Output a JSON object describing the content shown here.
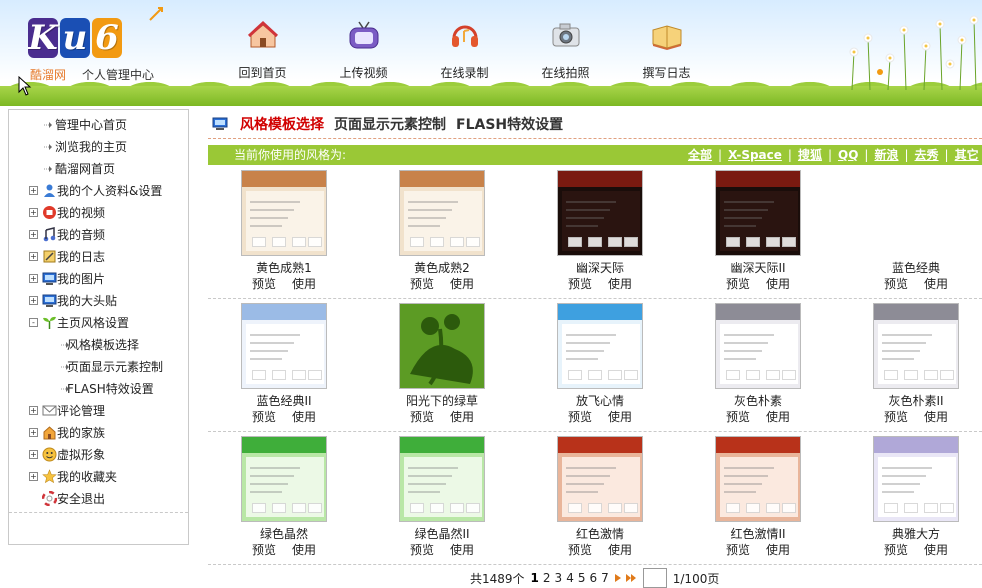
{
  "header": {
    "logo_letters": [
      "K",
      "u",
      "6"
    ],
    "site_name": "酷溜网",
    "site_sub": "个人管理中心",
    "nav": [
      {
        "label": "回到首页",
        "icon": "home-icon"
      },
      {
        "label": "上传视频",
        "icon": "tv-icon"
      },
      {
        "label": "在线录制",
        "icon": "headphones-icon"
      },
      {
        "label": "在线拍照",
        "icon": "camera-icon"
      },
      {
        "label": "撰写日志",
        "icon": "book-icon"
      }
    ]
  },
  "sidebar": {
    "items": [
      {
        "label": "管理中心首页",
        "kind": "leaf"
      },
      {
        "label": "浏览我的主页",
        "kind": "leaf"
      },
      {
        "label": "酷溜网首页",
        "kind": "leaf"
      },
      {
        "label": "我的个人资料&设置",
        "kind": "branch",
        "toggle": "+",
        "icon": "user-icon"
      },
      {
        "label": "我的视频",
        "kind": "branch",
        "toggle": "+",
        "icon": "video-icon"
      },
      {
        "label": "我的音频",
        "kind": "branch",
        "toggle": "+",
        "icon": "music-icon"
      },
      {
        "label": "我的日志",
        "kind": "branch",
        "toggle": "+",
        "icon": "journal-icon"
      },
      {
        "label": "我的图片",
        "kind": "branch",
        "toggle": "+",
        "icon": "monitor-icon"
      },
      {
        "label": "我的大头贴",
        "kind": "branch",
        "toggle": "+",
        "icon": "monitor-icon"
      },
      {
        "label": "主页风格设置",
        "kind": "branch",
        "toggle": "-",
        "icon": "plant-icon"
      },
      {
        "label": "风格模板选择",
        "kind": "sub"
      },
      {
        "label": "页面显示元素控制",
        "kind": "sub"
      },
      {
        "label": "FLASH特效设置",
        "kind": "sub"
      },
      {
        "label": "评论管理",
        "kind": "branch",
        "toggle": "+",
        "icon": "mail-icon"
      },
      {
        "label": "我的家族",
        "kind": "branch",
        "toggle": "+",
        "icon": "house-icon"
      },
      {
        "label": "虚拟形象",
        "kind": "branch",
        "toggle": "+",
        "icon": "face-icon"
      },
      {
        "label": "我的收藏夹",
        "kind": "branch",
        "toggle": "+",
        "icon": "star-icon"
      },
      {
        "label": "安全退出",
        "kind": "exit",
        "icon": "lifebuoy-icon"
      }
    ]
  },
  "tabs": [
    {
      "label": "风格模板选择",
      "active": true
    },
    {
      "label": "页面显示元素控制",
      "active": false
    },
    {
      "label": "FLASH特效设置",
      "active": false
    }
  ],
  "style_bar": {
    "label": "当前你使用的风格为:",
    "filters": [
      "全部",
      "X-Space",
      "搜狐",
      "QQ",
      "新浪",
      "去秀",
      "其它"
    ]
  },
  "card_actions": {
    "preview": "预览",
    "use": "使用"
  },
  "templates": [
    [
      {
        "title": "黄色成熟1",
        "theme": "tan"
      },
      {
        "title": "黄色成熟2",
        "theme": "tan"
      },
      {
        "title": "幽深天际",
        "theme": "dark"
      },
      {
        "title": "幽深天际II",
        "theme": "dark"
      },
      {
        "title": "蓝色经典",
        "theme": "blank"
      }
    ],
    [
      {
        "title": "蓝色经典II",
        "theme": "blue"
      },
      {
        "title": "阳光下的绿草",
        "theme": "green-art"
      },
      {
        "title": "放飞心情",
        "theme": "sky"
      },
      {
        "title": "灰色朴素",
        "theme": "gray"
      },
      {
        "title": "灰色朴素II",
        "theme": "gray"
      }
    ],
    [
      {
        "title": "绿色晶然",
        "theme": "green"
      },
      {
        "title": "绿色晶然II",
        "theme": "green"
      },
      {
        "title": "红色激情",
        "theme": "red"
      },
      {
        "title": "红色激情II",
        "theme": "red"
      },
      {
        "title": "典雅大方",
        "theme": "lavender"
      }
    ]
  ],
  "pager": {
    "total": "共1489个",
    "pages": [
      "1",
      "2",
      "3",
      "4",
      "5",
      "6",
      "7"
    ],
    "current": "1",
    "input_value": "",
    "suffix": "1/100页"
  },
  "colors": {
    "accent_red": "#d10000",
    "bar_green": "#9ac836",
    "logo_purple": "#4a2d8f",
    "logo_blue": "#1a4fb4",
    "logo_orange": "#f29a12"
  }
}
